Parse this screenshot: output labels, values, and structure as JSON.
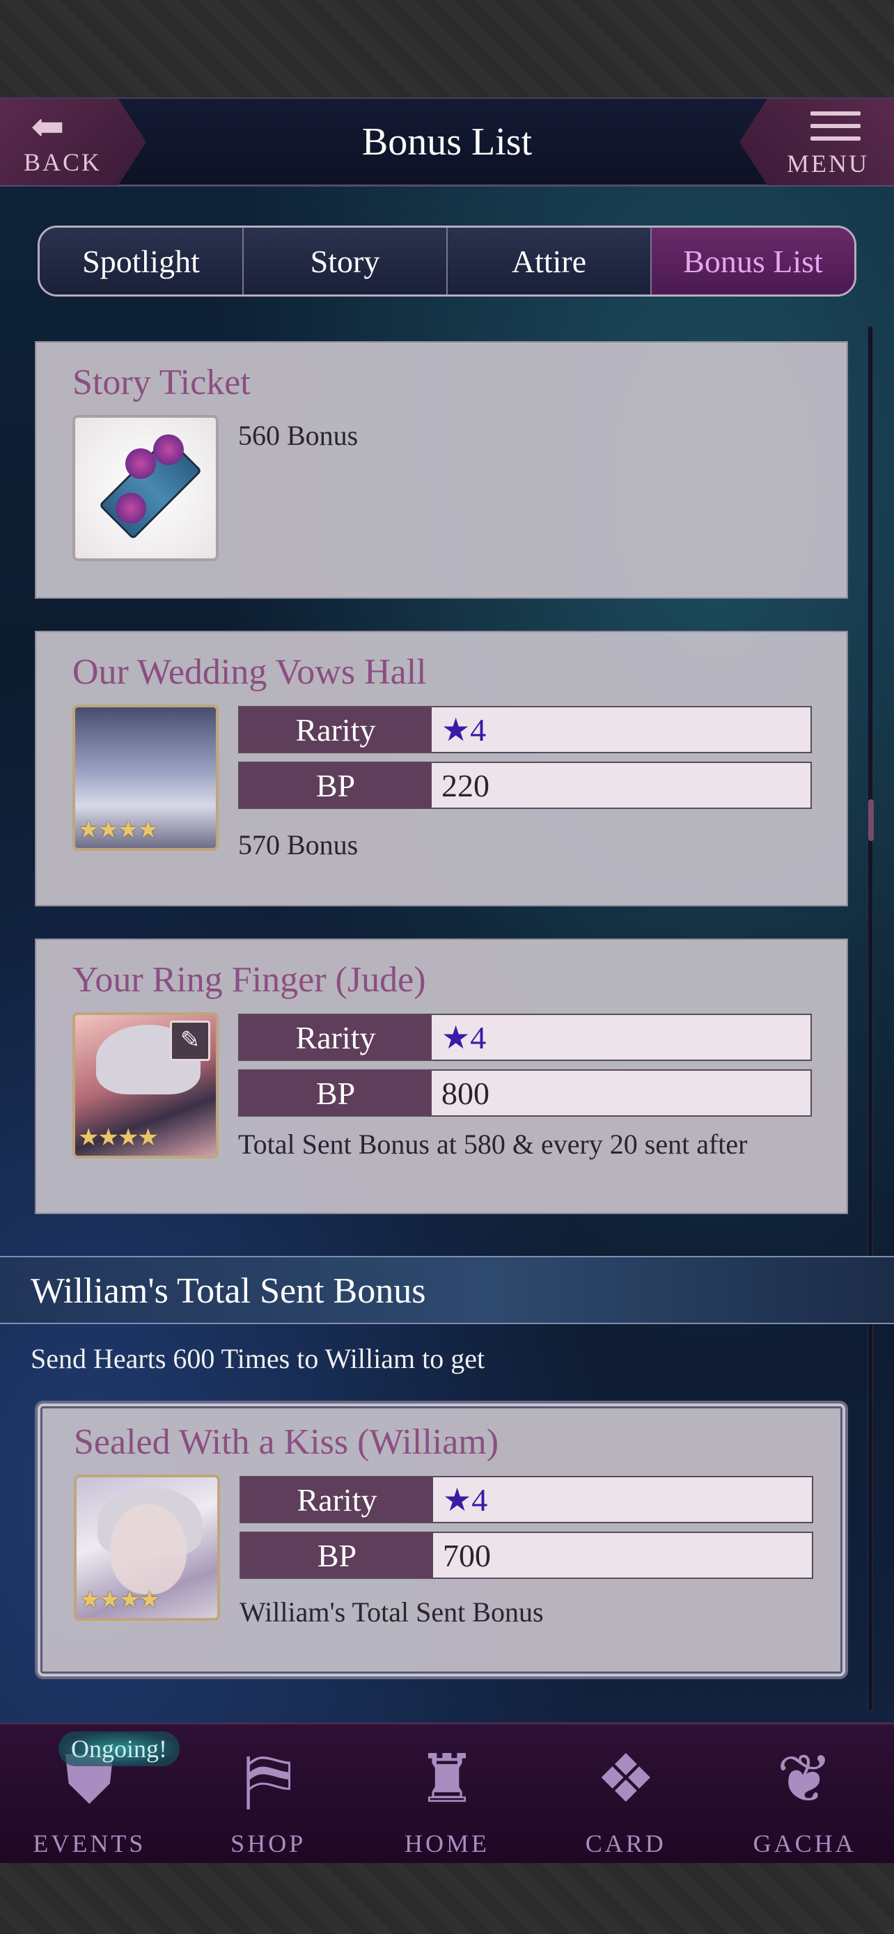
{
  "header": {
    "back_label": "BACK",
    "title": "Bonus List",
    "menu_label": "MENU"
  },
  "tabs": [
    {
      "label": "Spotlight",
      "active": false
    },
    {
      "label": "Story",
      "active": false
    },
    {
      "label": "Attire",
      "active": false
    },
    {
      "label": "Bonus List",
      "active": true
    }
  ],
  "cards": [
    {
      "title": "Story Ticket",
      "bonus": "560 Bonus",
      "icon": "story-ticket-icon"
    },
    {
      "title": "Our Wedding Vows Hall",
      "rarity_label": "Rarity",
      "rarity": "★4",
      "bp_label": "BP",
      "bp": "220",
      "bonus": "570 Bonus",
      "stars": "★★★★"
    },
    {
      "title": "Your Ring Finger (Jude)",
      "rarity_label": "Rarity",
      "rarity": "★4",
      "bp_label": "BP",
      "bp": "800",
      "bonus": "Total Sent Bonus at 580 & every 20 sent after",
      "stars": "★★★★"
    }
  ],
  "section": {
    "title": "William's Total Sent Bonus",
    "subtitle": "Send Hearts 600 Times to William to get"
  },
  "reward_card": {
    "title": "Sealed With a Kiss (William)",
    "rarity_label": "Rarity",
    "rarity": "★4",
    "bp_label": "BP",
    "bp": "700",
    "bonus": "William's Total Sent Bonus",
    "stars": "★★★★"
  },
  "bottom_nav": [
    {
      "label": "EVENTS",
      "icon": "events-crest-icon",
      "badge": "Ongoing!"
    },
    {
      "label": "SHOP",
      "icon": "shop-sign-icon"
    },
    {
      "label": "HOME",
      "icon": "castle-icon"
    },
    {
      "label": "CARD",
      "icon": "cards-icon"
    },
    {
      "label": "GACHA",
      "icon": "butterfly-icon"
    }
  ],
  "colors": {
    "title_purple": "#8c4e82",
    "rarity_blue": "#3a1aa6",
    "active_tab": "#e6a6ee"
  }
}
